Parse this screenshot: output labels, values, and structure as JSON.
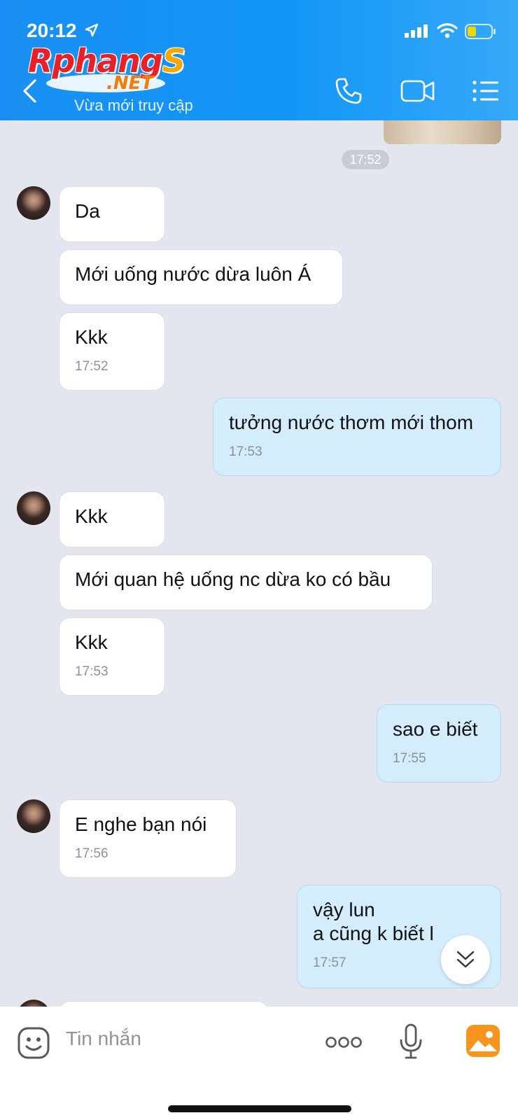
{
  "status_bar": {
    "time": "20:12"
  },
  "header": {
    "logo_main": "Rphang",
    "logo_s": "S",
    "logo_net": ".NET",
    "subtitle": "Vừa mới truy cập"
  },
  "chat": {
    "top_time": "17:52",
    "messages": [
      {
        "text": "Da"
      },
      {
        "text": "Mới uống nước dừa luôn Á"
      },
      {
        "text": "Kkk",
        "time": "17:52"
      },
      {
        "text": "tưởng nước thơm mới thom",
        "time": "17:53"
      },
      {
        "text": "Kkk"
      },
      {
        "text": "Mới quan hệ uống nc dừa ko có bầu"
      },
      {
        "text": "Kkk",
        "time": "17:53"
      },
      {
        "text": "sao e biết",
        "time": "17:55"
      },
      {
        "text": "E nghe bạn nói",
        "time": "17:56"
      },
      {
        "text": "vậy lun\na cũng k biết l",
        "time": "17:57"
      }
    ]
  },
  "input": {
    "placeholder": "Tin nhắn"
  },
  "colors": {
    "header": "#1a8ff3",
    "sent_bubble": "#d3edfc",
    "received_bubble": "#ffffff",
    "chat_bg": "#e3e6ee"
  }
}
